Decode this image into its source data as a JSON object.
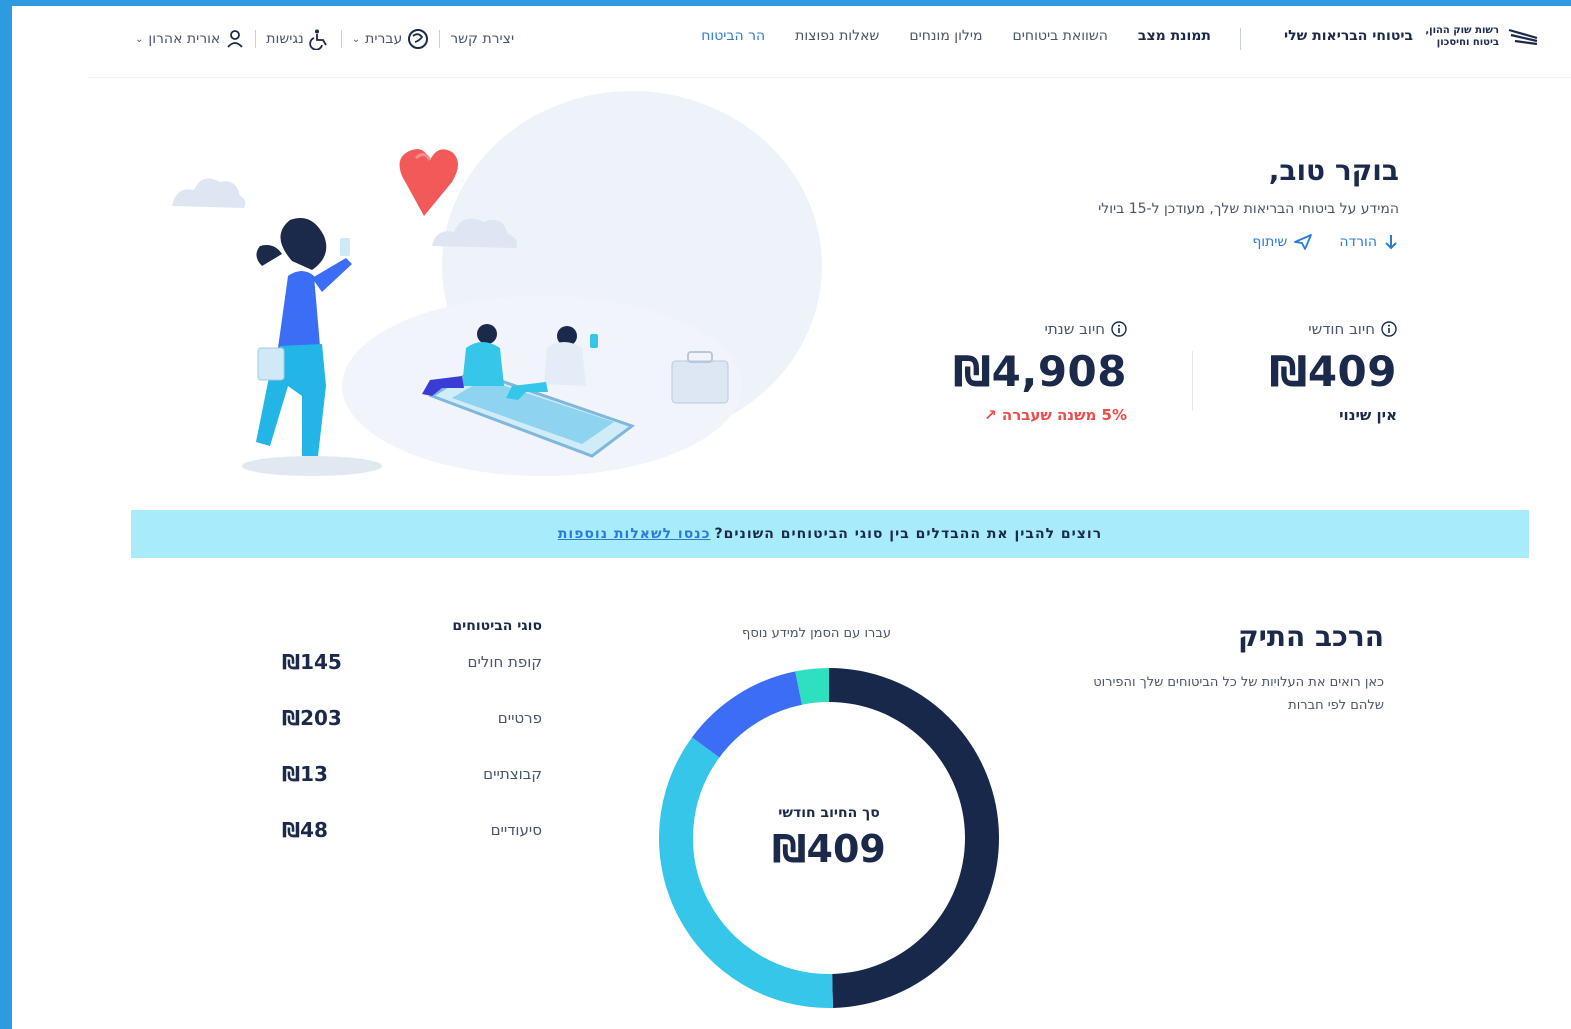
{
  "header": {
    "logo_line1": "רשות שוק ההון,",
    "logo_line2": "ביטוח וחיסכון",
    "brand": "ביטוחי הבריאות שלי",
    "nav": [
      {
        "label": "תמונת מצב",
        "state": "active"
      },
      {
        "label": "השוואת ביטוחים",
        "state": "normal"
      },
      {
        "label": "מילון מונחים",
        "state": "normal"
      },
      {
        "label": "שאלות נפוצות",
        "state": "normal"
      },
      {
        "label": "הר הביטוח",
        "state": "link"
      }
    ],
    "contact": "יצירת קשר",
    "language": "עברית",
    "accessibility": "נגישות",
    "user": "אורית אהרון"
  },
  "greeting": {
    "title": "בוקר טוב,",
    "subtitle": "המידע על ביטוחי הבריאות שלך, מעודכן ל-15 ביולי",
    "download": "הורדה",
    "share": "שיתוף"
  },
  "charges": {
    "monthly": {
      "label": "חיוב חודשי",
      "amount": "₪409",
      "note": "אין שינוי"
    },
    "annual": {
      "label": "חיוב שנתי",
      "amount": "₪4,908",
      "note": "5% משנה שעברה"
    }
  },
  "banner": {
    "text": "רוצים להבין את ההבדלים בין סוגי הביטוחים השונים?",
    "link": "כנסו לשאלות נוספות"
  },
  "portfolio": {
    "title": "הרכב התיק",
    "description": "כאן רואים את העלויות של כל הביטוחים שלך והפירוט שלהם לפי חברות",
    "hover_hint": "עברו עם הסמן למידע נוסף",
    "total_label": "סך החיוב חודשי",
    "total_value": "₪409",
    "types_header": "סוגי הביטוחים",
    "types": [
      {
        "name": "קופת חולים",
        "value": "₪145"
      },
      {
        "name": "פרטיים",
        "value": "₪203"
      },
      {
        "name": "קבוצתיים",
        "value": "₪13"
      },
      {
        "name": "סיעודיים",
        "value": "₪48"
      }
    ]
  },
  "chart_data": {
    "type": "pie",
    "categories": [
      "פרטיים",
      "קופת חולים",
      "סיעודיים",
      "קבוצתיים"
    ],
    "values": [
      203,
      145,
      48,
      13
    ],
    "colors": [
      "#17284a",
      "#35c6ea",
      "#3b6ef5",
      "#2ee0c0"
    ]
  }
}
